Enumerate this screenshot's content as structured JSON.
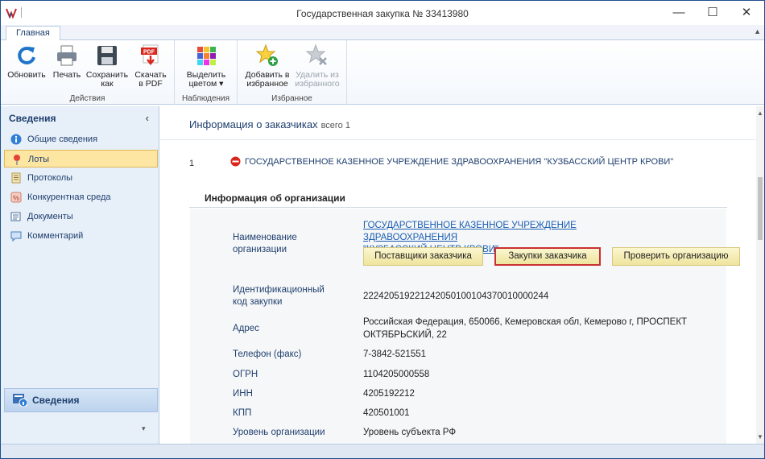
{
  "window": {
    "title": "Государственная закупка № 33413980",
    "minimize_glyph": "—",
    "maximize_glyph": "☐",
    "close_glyph": "✕"
  },
  "ribbon": {
    "tab": "Главная",
    "groups": [
      {
        "label": "Действия"
      },
      {
        "label": "Наблюдения"
      },
      {
        "label": "Избранное"
      }
    ],
    "buttons": {
      "refresh": "Обновить",
      "print": "Печать",
      "save_line1": "Сохранить",
      "save_line2": "как",
      "pdf_line1": "Скачать",
      "pdf_line2": "в PDF",
      "highlight_line1": "Выделить",
      "highlight_line2": "цветом ▾",
      "fav_add_line1": "Добавить в",
      "fav_add_line2": "избранное",
      "fav_remove_line1": "Удалить из",
      "fav_remove_line2": "избранного"
    },
    "pdf_badge": "PDF"
  },
  "sidebar": {
    "header": "Сведения",
    "collapse_glyph": "‹",
    "items": [
      {
        "label": "Общие сведения",
        "icon": "info-icon"
      },
      {
        "label": "Лоты",
        "icon": "pin-icon"
      },
      {
        "label": "Протоколы",
        "icon": "document-icon"
      },
      {
        "label": "Конкурентная среда",
        "icon": "percent-icon"
      },
      {
        "label": "Документы",
        "icon": "documents-icon"
      },
      {
        "label": "Комментарий",
        "icon": "comment-icon"
      }
    ],
    "selected_index": 1,
    "bottom_button": "Сведения",
    "more_glyph": "▾"
  },
  "content": {
    "section_title": "Информация о заказчиках",
    "count_text": "всего 1",
    "customer": {
      "number": "1",
      "name": "ГОСУДАРСТВЕННОЕ КАЗЕННОЕ УЧРЕЖДЕНИЕ ЗДРАВООХРАНЕНИЯ \"КУЗБАССКИЙ ЦЕНТР КРОВИ\""
    },
    "org_section_title": "Информация об организации",
    "fields": {
      "name_label_1": "Наименование",
      "name_label_2": "организации",
      "name_link_1": "ГОСУДАРСТВЕННОЕ КАЗЕННОЕ УЧРЕЖДЕНИЕ ЗДРАВООХРАНЕНИЯ",
      "name_link_2": "\"КУЗБАССКИЙ ЦЕНТР КРОВИ\"",
      "ikz_label_1": "Идентификационный",
      "ikz_label_2": "код закупки",
      "ikz_value": "222420519221242050100104370010000244",
      "address_label": "Адрес",
      "address_value_1": "Российская Федерация, 650066, Кемеровская обл, Кемерово г, ПРОСПЕКТ",
      "address_value_2": "ОКТЯБРЬСКИЙ, 22",
      "phone_label": "Телефон (факс)",
      "phone_value": "7-3842-521551",
      "ogrn_label": "ОГРН",
      "ogrn_value": "1104205000558",
      "inn_label": "ИНН",
      "inn_value": "4205192212",
      "kpp_label": "КПП",
      "kpp_value": "420501001",
      "level_label": "Уровень организации",
      "level_value": "Уровень субъекта РФ"
    },
    "buttons": {
      "suppliers": "Поставщики заказчика",
      "purchases": "Закупки заказчика",
      "check": "Проверить организацию"
    }
  },
  "scrollbar": {
    "up_glyph": "▲",
    "down_glyph": "▼"
  },
  "colors": {
    "accent": "#1f3f6e",
    "link": "#1a5fb4",
    "selection": "#fde5a2",
    "button_highlight_border": "#c93030"
  }
}
